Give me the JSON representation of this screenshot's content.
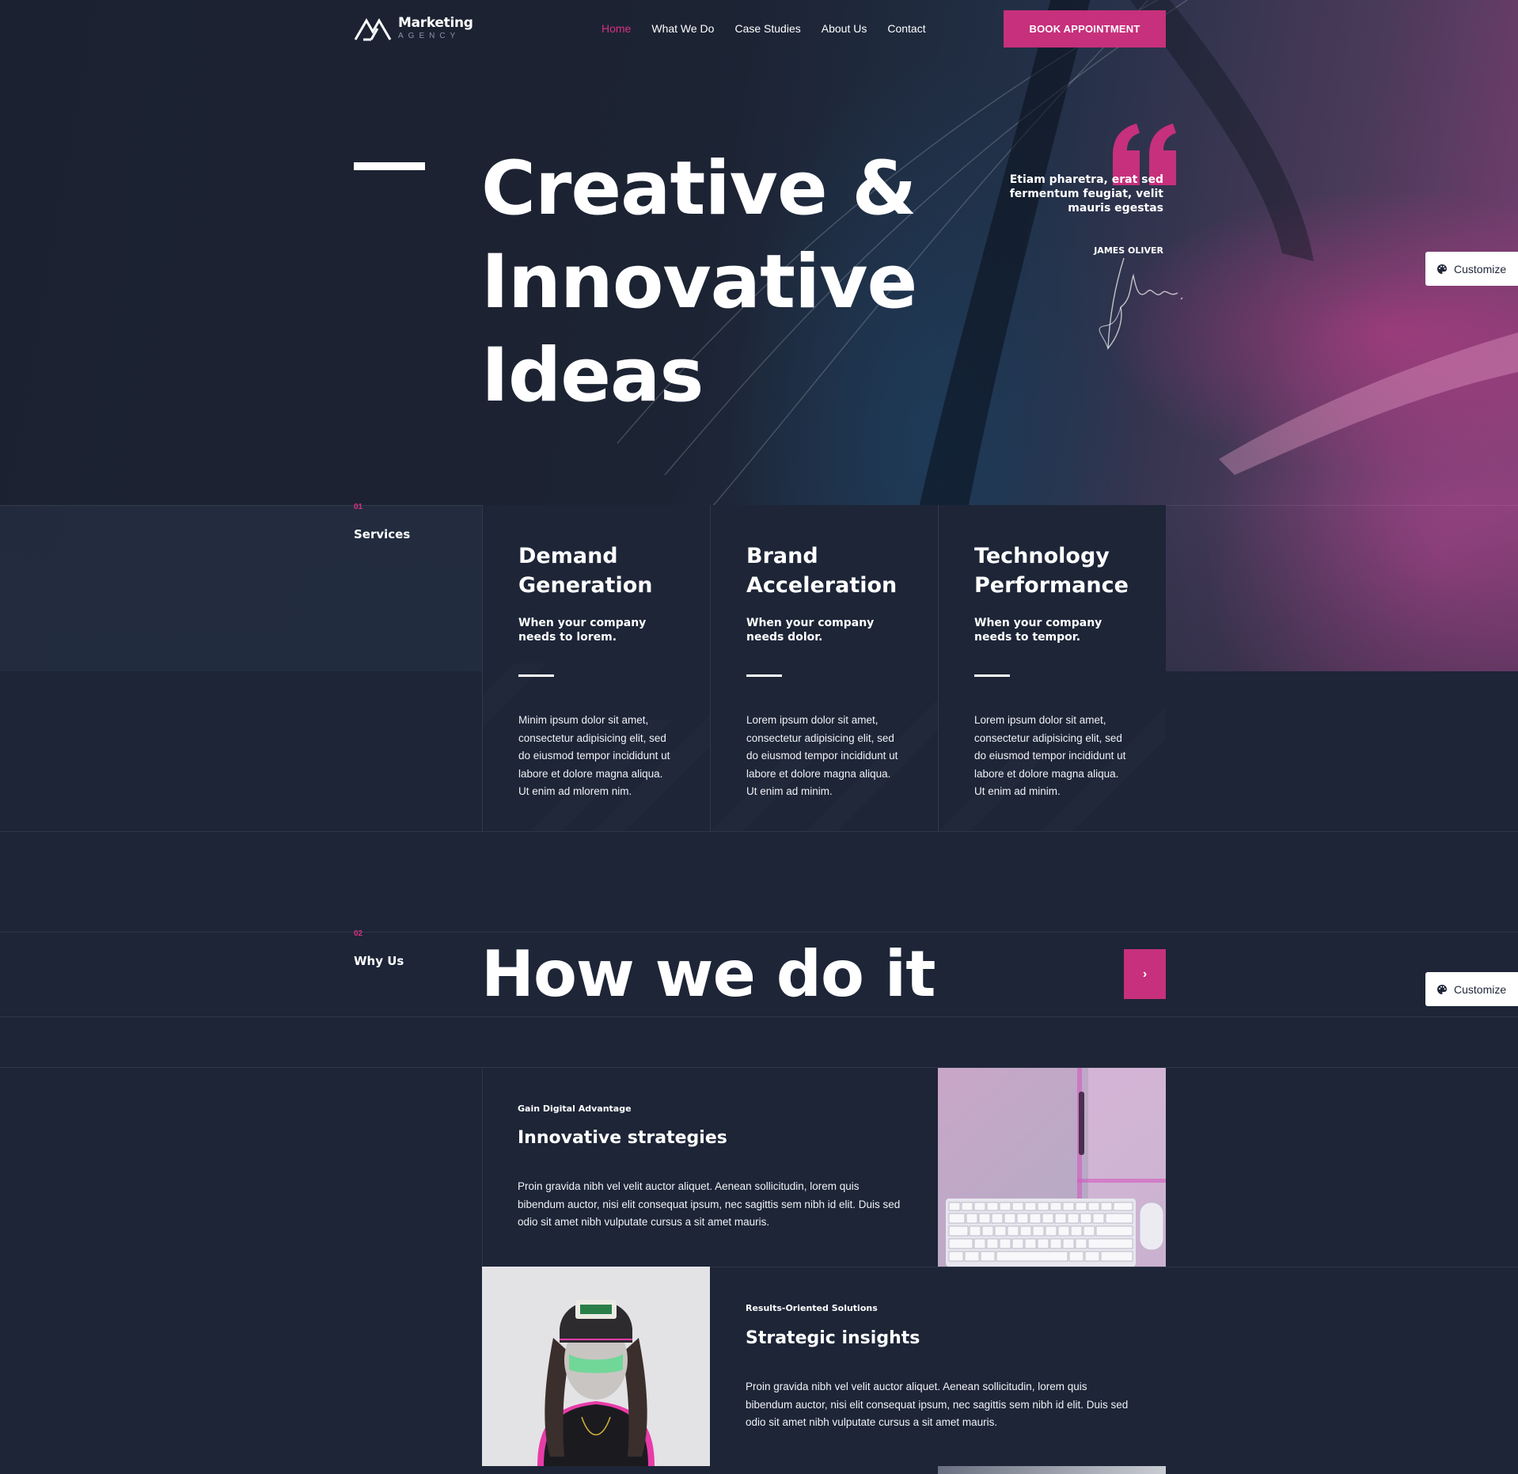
{
  "header": {
    "logo_title": "Marketing",
    "logo_sub": "AGENCY",
    "nav": [
      {
        "label": "Home",
        "active": true
      },
      {
        "label": "What We Do",
        "active": false
      },
      {
        "label": "Case Studies",
        "active": false
      },
      {
        "label": "About Us",
        "active": false
      },
      {
        "label": "Contact",
        "active": false
      }
    ],
    "cta_label": "BOOK APPOINTMENT"
  },
  "hero": {
    "title_lines": [
      "Creative &",
      "Innovative",
      "Ideas"
    ],
    "quote": "Etiam pharetra, erat sed fermentum feugiat, velit mauris egestas",
    "author": "JAMES OLIVER"
  },
  "customize_label": "Customize",
  "services": {
    "num": "01",
    "label": "Services",
    "cards": [
      {
        "title_line1": "Demand",
        "title_line2": "Generation",
        "subtitle": "When your company needs to lorem.",
        "text": "Minim ipsum dolor sit amet, consectetur adipisicing elit, sed do eiusmod tempor incididunt ut labore et dolore magna aliqua. Ut enim ad mlorem nim."
      },
      {
        "title_line1": "Brand",
        "title_line2": "Acceleration",
        "subtitle": "When your company needs dolor.",
        "text": "Lorem ipsum dolor sit amet, consectetur adipisicing elit, sed do eiusmod tempor incididunt ut labore et dolore magna aliqua. Ut enim ad minim."
      },
      {
        "title_line1": "Technology",
        "title_line2": "Performance",
        "subtitle": "When your company needs to tempor.",
        "text": "Lorem ipsum dolor sit amet, consectetur adipisicing elit, sed do eiusmod tempor incididunt ut labore et dolore magna aliqua. Ut enim ad minim."
      }
    ]
  },
  "why": {
    "num": "02",
    "label": "Why Us",
    "title": "How we do it",
    "arrow": "›",
    "features": [
      {
        "kicker": "Gain Digital Advantage",
        "title": "Innovative strategies",
        "text": "Proin gravida nibh vel velit auctor aliquet. Aenean sollicitudin, lorem quis bibendum auctor, nisi elit consequat ipsum, nec sagittis sem nibh id elit. Duis sed odio sit amet nibh vulputate cursus a sit amet mauris."
      },
      {
        "kicker": "Results-Oriented Solutions",
        "title": "Strategic insights",
        "text": "Proin gravida nibh vel velit auctor aliquet. Aenean sollicitudin, lorem quis bibendum auctor, nisi elit consequat ipsum, nec sagittis sem nibh id elit. Duis sed odio sit amet nibh vulputate cursus a sit amet mauris."
      }
    ]
  },
  "colors": {
    "accent": "#c7307c",
    "background": "#1d2537"
  },
  "icons": {
    "palette": "palette-icon",
    "logo": "logo-mark-icon",
    "quote": "quote-icon",
    "signature": "signature-icon",
    "arrow": "chevron-right-icon"
  }
}
